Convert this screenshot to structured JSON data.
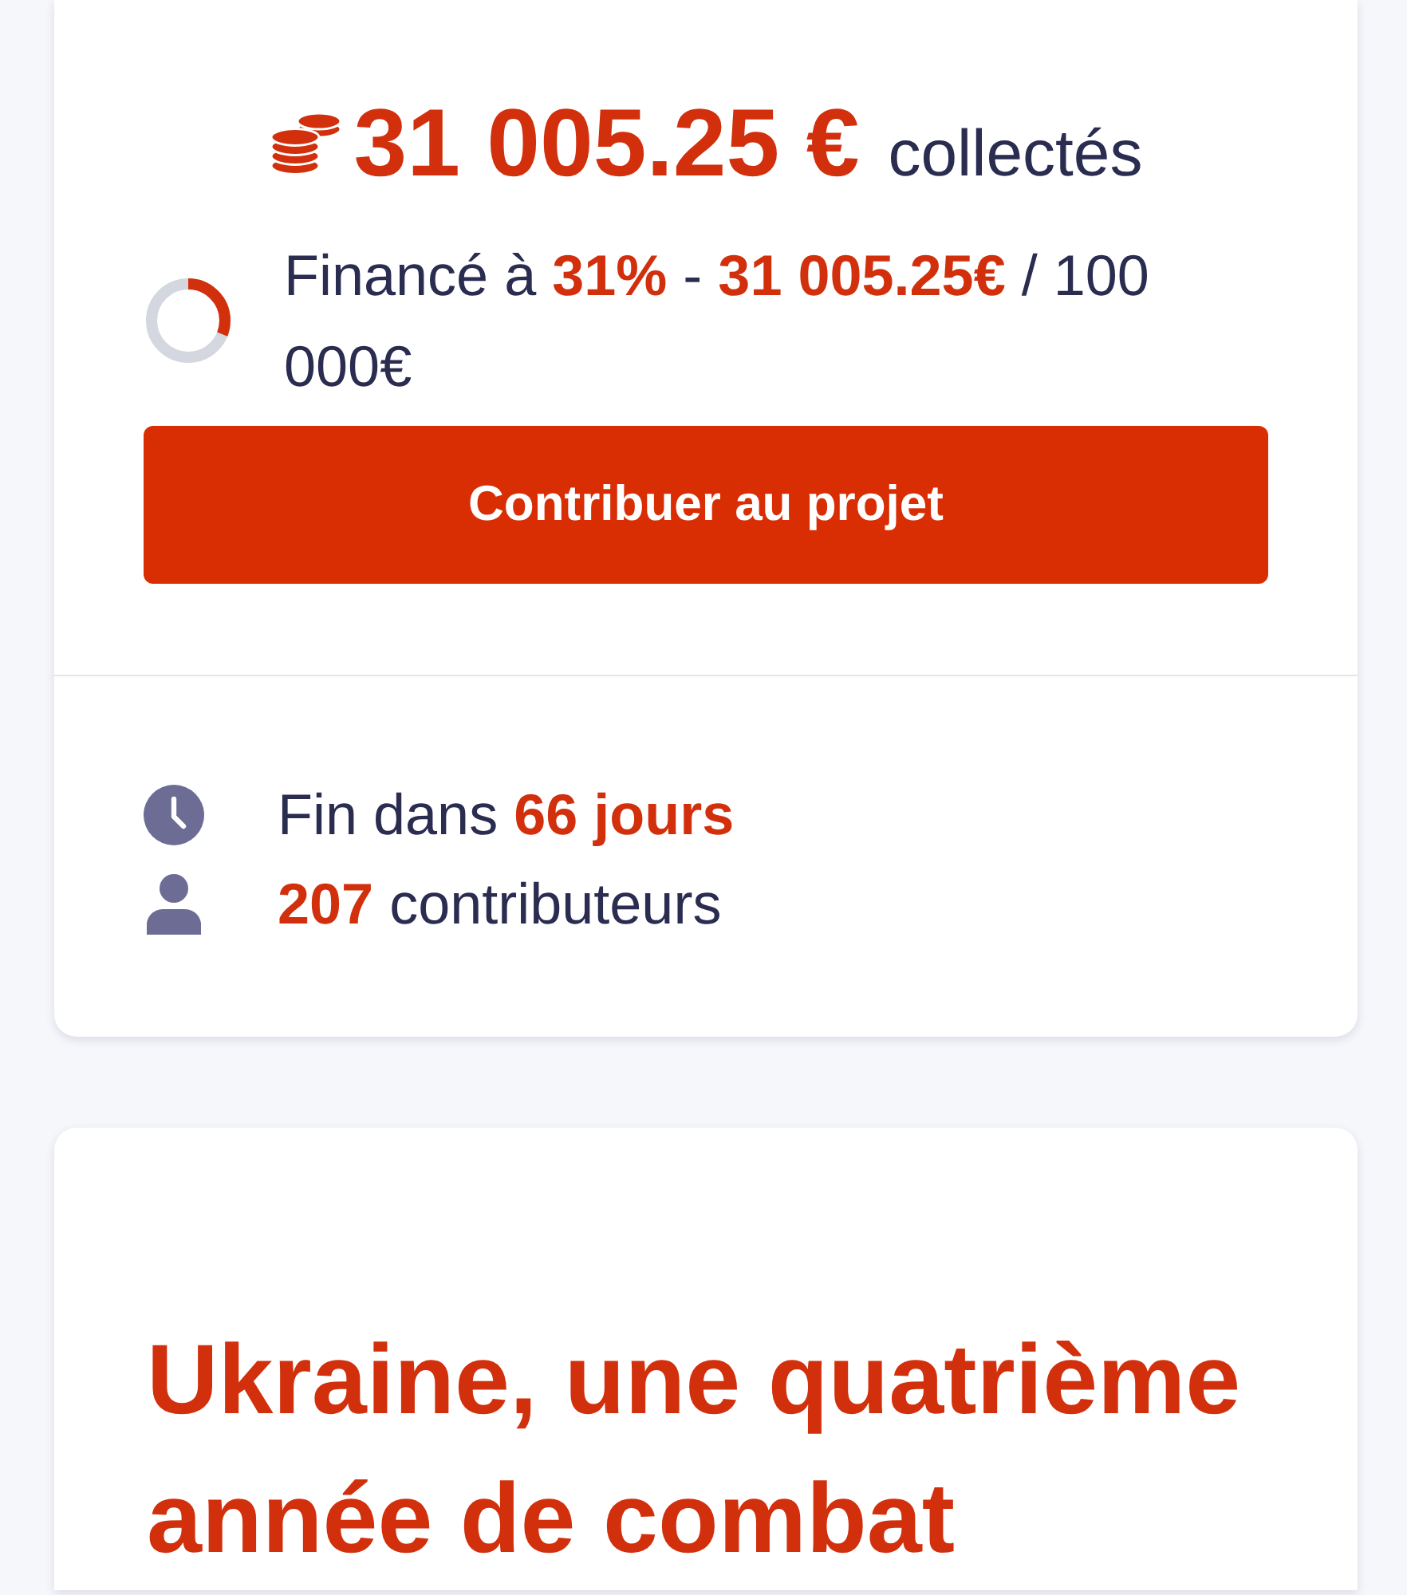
{
  "funding": {
    "amount": "31 005.25 €",
    "amount_label": "collectés",
    "progress": {
      "level": 0.31,
      "text": "Financé à **31%** - **31 005.25€** / 100 000€"
    },
    "button": "Contribuer au projet"
  },
  "stats": [
    {
      "kind": "time",
      "text": "Fin dans **66 jours**"
    },
    {
      "kind": "contributors",
      "text": "**207** contributeurs"
    }
  ],
  "article": {
    "title": "Ukraine, une quatrième année de combat"
  }
}
